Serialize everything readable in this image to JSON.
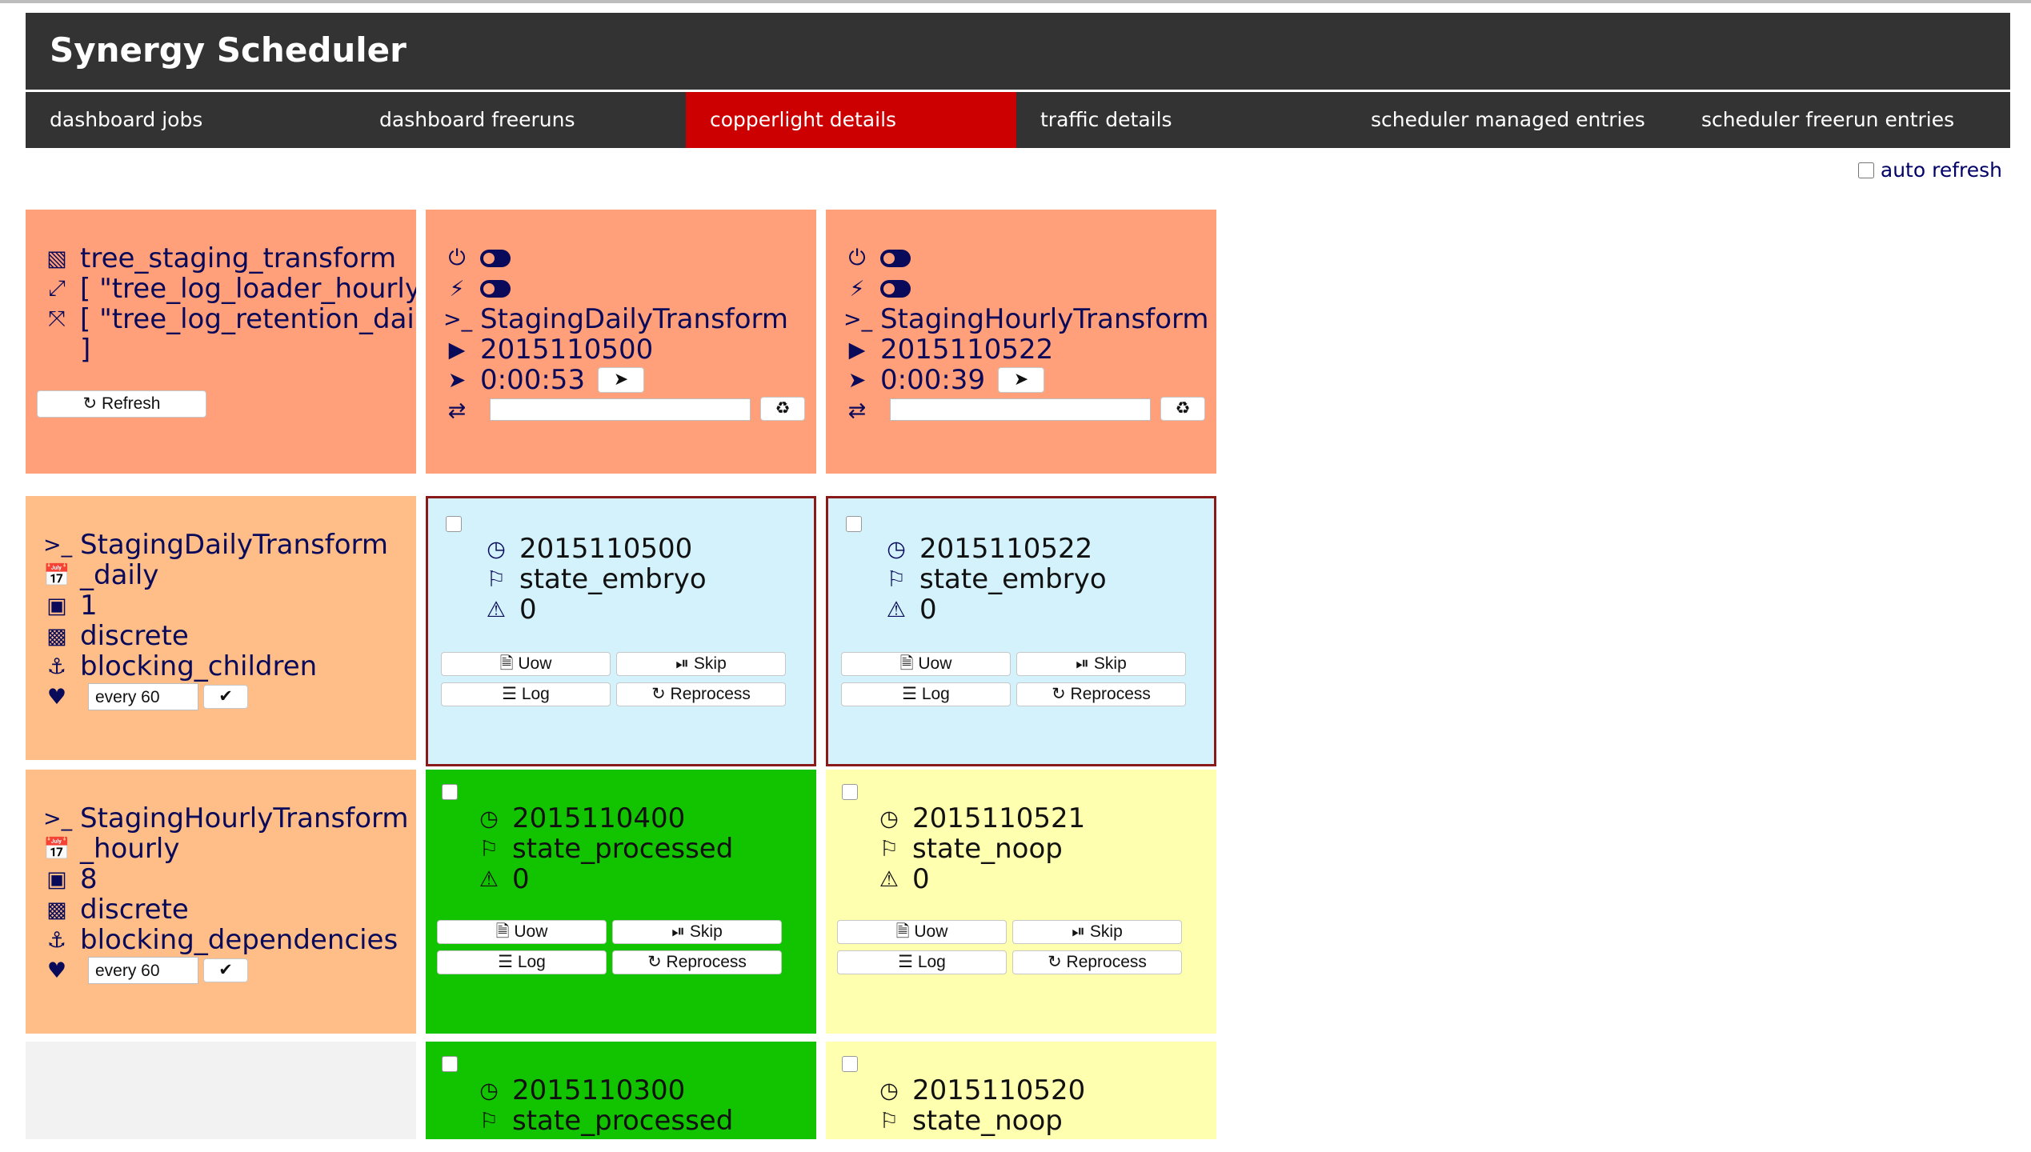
{
  "app": {
    "title": "Synergy Scheduler"
  },
  "nav": [
    {
      "label": "dashboard jobs",
      "active": false
    },
    {
      "label": "dashboard freeruns",
      "active": false
    },
    {
      "label": "copperlight details",
      "active": true
    },
    {
      "label": "traffic details",
      "active": false
    },
    {
      "label": "scheduler managed entries",
      "active": false
    },
    {
      "label": "scheduler freerun entries",
      "active": false
    }
  ],
  "auto_refresh": {
    "label": "auto refresh",
    "checked": false
  },
  "tree": {
    "name": "tree_staging_transform",
    "dependent_on": "[ \"tree_log_loader_hourly\" ]",
    "dependant_trees": "[ \"tree_log_retention_daily\"",
    "closing_bracket": "]",
    "refresh_label": "Refresh"
  },
  "processes": [
    {
      "name": "StagingDailyTransform",
      "timeperiod": "2015110500",
      "duration": "0:00:53"
    },
    {
      "name": "StagingHourlyTransform",
      "timeperiod": "2015110522",
      "duration": "0:00:39"
    }
  ],
  "process_details": [
    {
      "name": "StagingDailyTransform",
      "time_qualifier": "_daily",
      "count": "1",
      "kind": "discrete",
      "blocking": "blocking_children",
      "interval": "every 60"
    },
    {
      "name": "StagingHourlyTransform",
      "time_qualifier": "_hourly",
      "count": "8",
      "kind": "discrete",
      "blocking": "blocking_dependencies",
      "interval": "every 60"
    }
  ],
  "job_buttons": {
    "uow": "Uow",
    "skip": "Skip",
    "log": "Log",
    "reprocess": "Reprocess"
  },
  "jobs": [
    {
      "timeperiod": "2015110500",
      "state": "state_embryo",
      "failures": "0",
      "color": "#d3f2fb"
    },
    {
      "timeperiod": "2015110522",
      "state": "state_embryo",
      "failures": "0",
      "color": "#d3f2fb"
    },
    {
      "timeperiod": "2015110400",
      "state": "state_processed",
      "failures": "0",
      "color": "#12c400"
    },
    {
      "timeperiod": "2015110521",
      "state": "state_noop",
      "failures": "0",
      "color": "#ffffb0"
    },
    {
      "timeperiod": "2015110300",
      "state": "state_processed",
      "color": "#12c400"
    },
    {
      "timeperiod": "2015110520",
      "state": "state_noop",
      "color": "#ffffb0"
    }
  ],
  "icons": {
    "tree": "sitemap-icon",
    "expand": "expand-icon",
    "compress": "compress-icon",
    "power": "power-icon",
    "bolt": "bolt-icon",
    "terminal": "terminal-icon",
    "play": "play-icon",
    "rocket": "rocket-icon",
    "retweet": "retweet-icon",
    "calendar": "calendar-icon",
    "cubes": "cubes-icon",
    "puzzle": "puzzle-icon",
    "anchor": "anchor-icon",
    "heartbeat": "heartbeat-icon",
    "clock": "clock-icon",
    "flag": "flag-icon",
    "warning": "warning-icon"
  },
  "colors": {
    "header": "#333333",
    "nav_active": "#cc0000",
    "orange": "#ffa07a",
    "peach": "#ffbe88",
    "text": "#0a0a5a"
  }
}
